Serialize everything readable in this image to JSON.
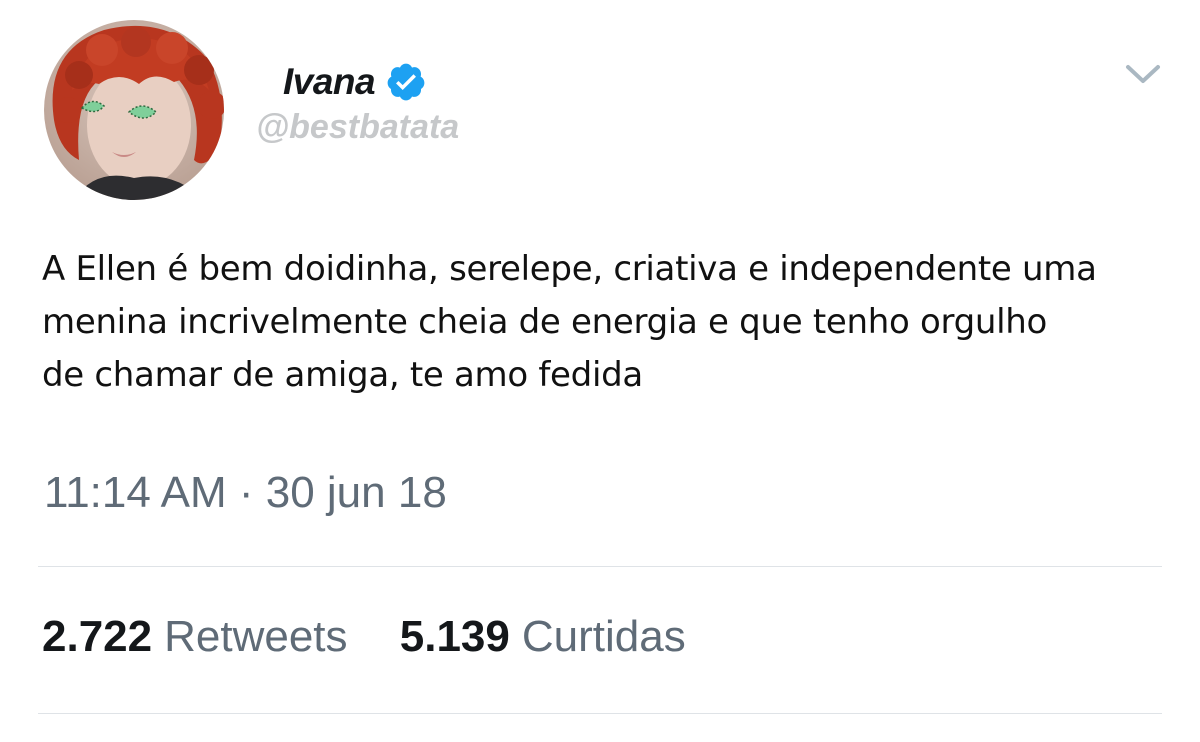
{
  "tweet": {
    "author": {
      "display_name": "Ivana",
      "handle": "@bestbatata",
      "verified": true,
      "avatar_icon": "profile-photo",
      "verified_icon": "verified-badge-icon"
    },
    "menu_icon": "chevron-down-icon",
    "text_lines": [
      "A Ellen é bem doidinha, serelepe, criativa e independente uma",
      "menina incrivelmente cheia de energia e que tenho orgulho",
      "de chamar de amiga, te amo fedida"
    ],
    "timestamp": "11:14 AM · 30 jun 18",
    "stats": {
      "retweets_count": "2.722",
      "retweets_label": "Retweets",
      "likes_count": "5.139",
      "likes_label": "Curtidas"
    }
  },
  "colors": {
    "verified_blue": "#1da1f2",
    "text_primary": "#14171a",
    "text_secondary": "#5f6b77",
    "handle_gray": "#c6c8ca",
    "divider": "#dfe3e7"
  }
}
